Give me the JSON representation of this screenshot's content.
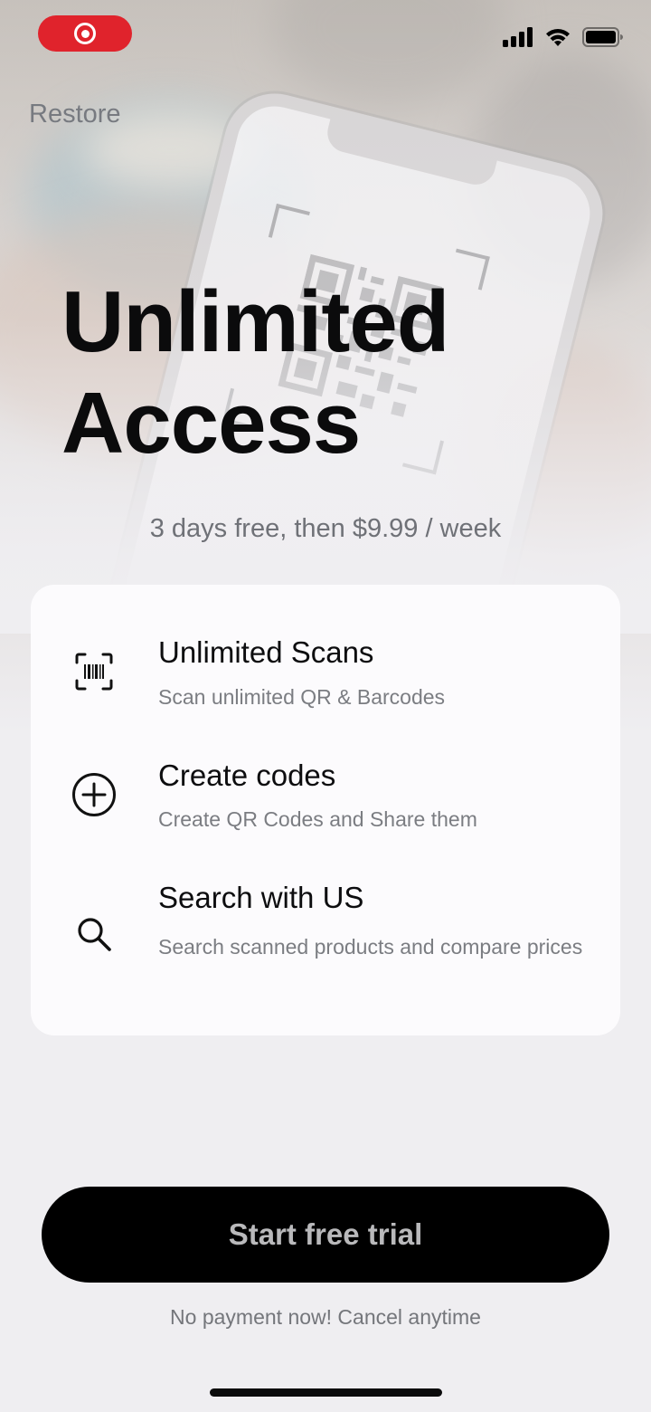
{
  "status_bar": {
    "recording_icon": "screen-recording-icon",
    "signal_icon": "cellular-signal-icon",
    "wifi_icon": "wifi-icon",
    "battery_icon": "battery-icon"
  },
  "header": {
    "restore_label": "Restore",
    "title_line1": "Unlimited",
    "title_line2": "Access",
    "price_text": "3 days free, then $9.99 / week"
  },
  "features": [
    {
      "icon": "barcode-scan-icon",
      "title": "Unlimited Scans",
      "description": "Scan unlimited QR & Barcodes"
    },
    {
      "icon": "plus-circle-icon",
      "title": "Create codes",
      "description": "Create QR Codes and Share them"
    },
    {
      "icon": "search-icon",
      "title": "Search with US",
      "description": "Search scanned products and compare prices"
    }
  ],
  "cta": {
    "button_label": "Start free trial",
    "note": "No payment now! Cancel anytime"
  },
  "colors": {
    "record_red": "#e0232c",
    "cta_background": "#000000",
    "card_background": "#fcfbfd",
    "page_background": "#efeef1"
  }
}
